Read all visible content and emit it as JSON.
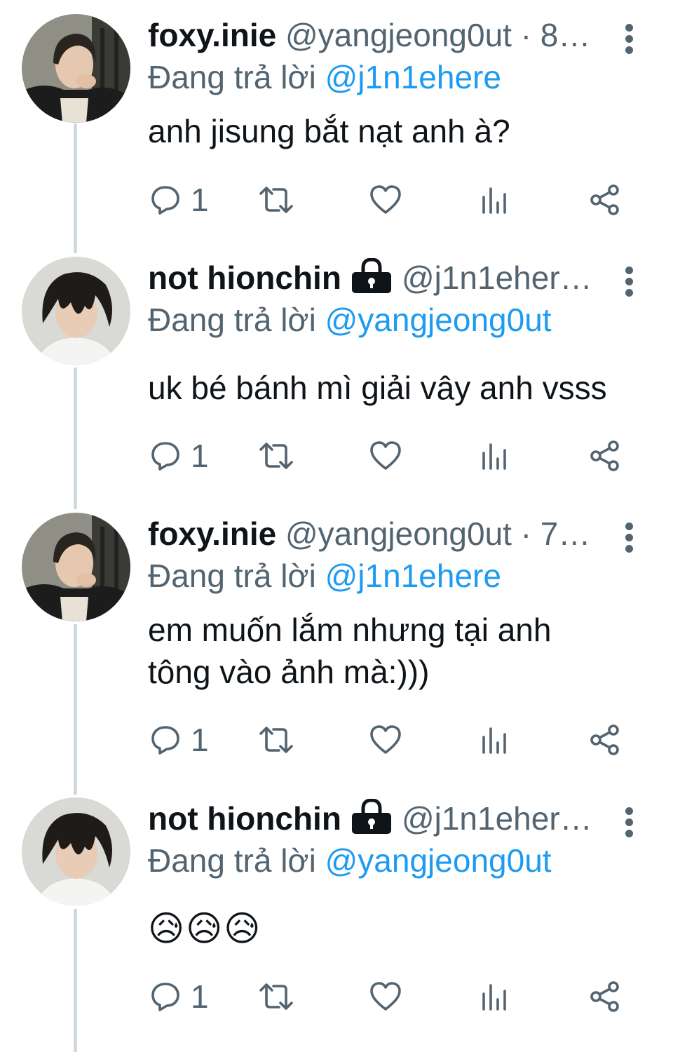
{
  "tweets": [
    {
      "name": "foxy.inie",
      "handle": "@yangjeong0ut · 8…",
      "locked": false,
      "replying_prefix": "Đang trả lời",
      "replying_to": "@j1n1ehere",
      "text": "anh jisung bắt nạt anh à?",
      "avatar_icon": "avatar-foxy-inie",
      "reply_count": "1"
    },
    {
      "name": "not hionchin",
      "handle": "@j1n1eher…",
      "locked": true,
      "replying_prefix": "Đang trả lời",
      "replying_to": "@yangjeong0ut",
      "text": "uk bé bánh mì giải vây anh vsss",
      "avatar_icon": "avatar-not-hionchin",
      "reply_count": "1"
    },
    {
      "name": "foxy.inie",
      "handle": "@yangjeong0ut · 7…",
      "locked": false,
      "replying_prefix": "Đang trả lời",
      "replying_to": "@j1n1ehere",
      "text": "em muốn lắm nhưng tại anh\ntông vào ảnh mà:)))",
      "avatar_icon": "avatar-foxy-inie",
      "reply_count": "1"
    },
    {
      "name": "not hionchin",
      "handle": "@j1n1eher…",
      "locked": true,
      "replying_prefix": "Đang trả lời",
      "replying_to": "@yangjeong0ut",
      "text": "😥😥😥",
      "avatar_icon": "avatar-not-hionchin",
      "reply_count": "1"
    }
  ],
  "icons": {
    "reply": "reply-icon",
    "retweet": "retweet-icon",
    "like": "heart-icon",
    "views": "views-chart-icon",
    "share": "share-icon",
    "more": "more-vertical-icon",
    "lock": "lock-icon"
  },
  "colors": {
    "text": "#0f1419",
    "secondary": "#536471",
    "link": "#1d9bf0",
    "thread_line": "#cfd9de"
  }
}
